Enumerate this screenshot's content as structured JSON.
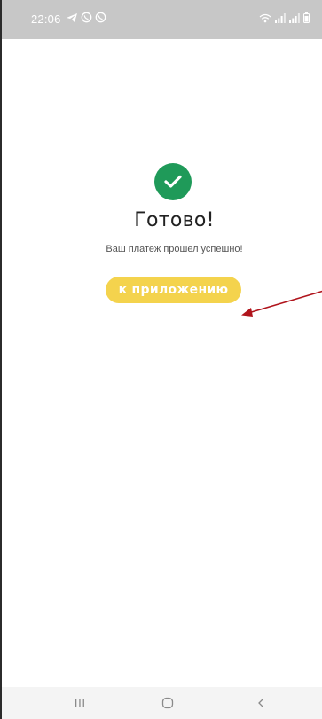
{
  "status_bar": {
    "time": "22:06",
    "left_icons": [
      "telegram-icon",
      "viber-icon",
      "viber-icon"
    ],
    "right_icons": [
      "wifi-icon",
      "signal-icon",
      "signal-icon",
      "battery-icon"
    ]
  },
  "content": {
    "status_icon": "check-circle-icon",
    "title": "Готово!",
    "subtitle": "Ваш платеж прошел успешно!",
    "button_label": "к приложению"
  },
  "nav_bar": {
    "buttons": [
      "recents-icon",
      "home-icon",
      "back-icon"
    ]
  },
  "colors": {
    "status_bar": "#c7c7c7",
    "success": "#1f9a59",
    "button": "#f4d34d",
    "annotation_arrow": "#b0141c"
  }
}
